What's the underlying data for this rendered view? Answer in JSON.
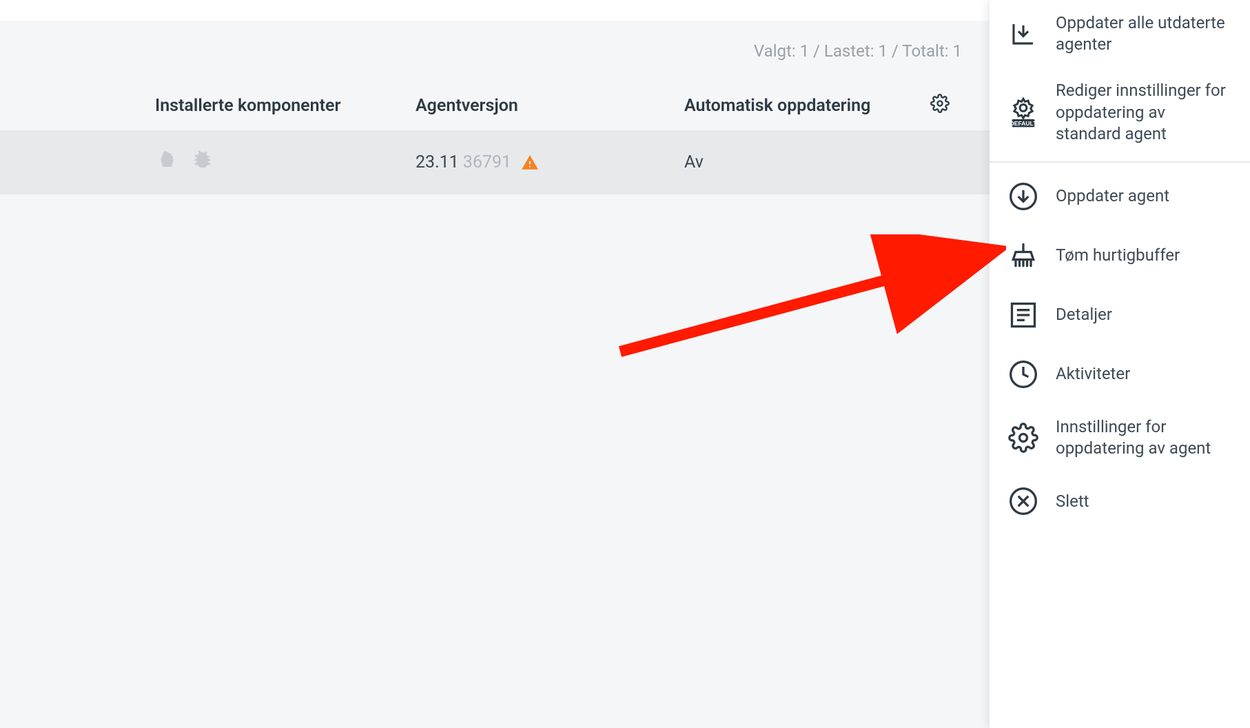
{
  "status": "Valgt: 1 / Lastet: 1 / Totalt: 1",
  "columns": {
    "components": "Installerte komponenter",
    "version": "Agentversjon",
    "autoupdate": "Automatisk oppdatering"
  },
  "row": {
    "version_main": "23.11",
    "version_build": "36791",
    "autoupdate": "Av"
  },
  "sidebar": {
    "update_all": "Oppdater alle utdaterte agenter",
    "edit_default": "Rediger innstillinger for oppdatering av standard agent",
    "update_agent": "Oppdater agent",
    "clear_cache": "Tøm hurtigbuffer",
    "details": "Detaljer",
    "activities": "Aktiviteter",
    "agent_update_settings": "Innstillinger for oppdatering av agent",
    "delete": "Slett"
  }
}
